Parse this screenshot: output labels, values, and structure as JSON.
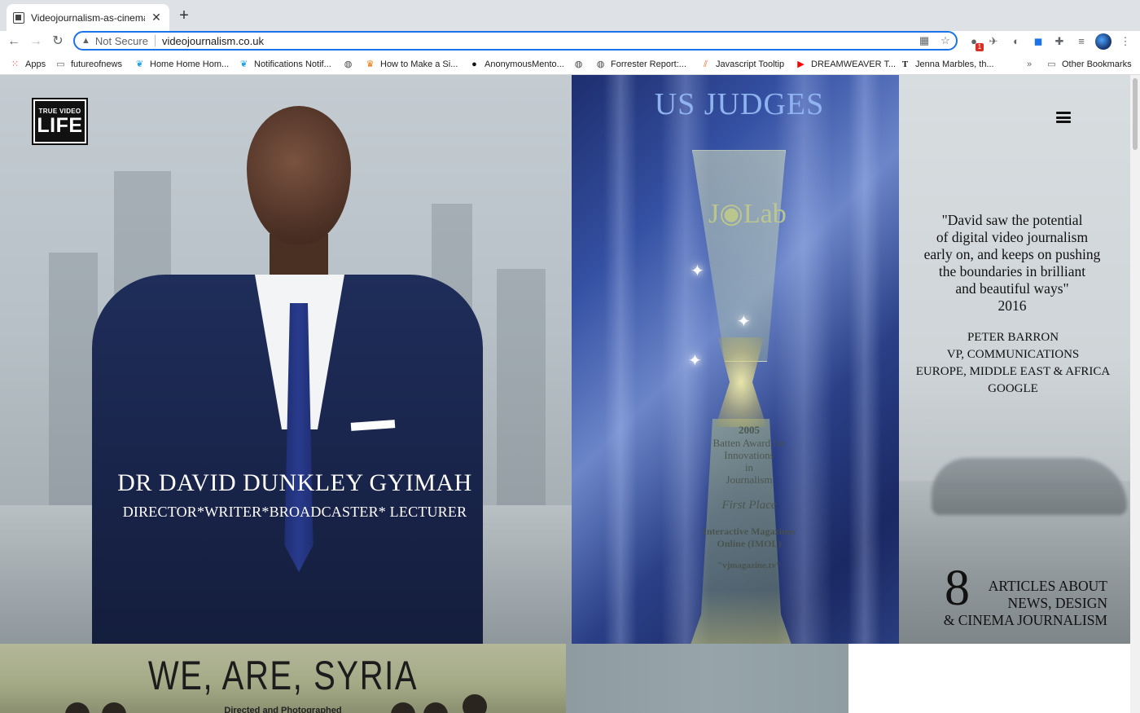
{
  "browser": {
    "tab_title": "Videojournalism-as-cinema | N",
    "security_label": "Not Secure",
    "url": "videojournalism.co.uk",
    "extension_badge": "1"
  },
  "bookmarks": [
    {
      "label": "Apps",
      "icon": "apps-grid-icon"
    },
    {
      "label": "futureofnews",
      "icon": "folder-icon"
    },
    {
      "label": "Home Home Hom...",
      "icon": "twitter-icon"
    },
    {
      "label": "Notifications Notif...",
      "icon": "twitter-icon"
    },
    {
      "label": "",
      "icon": "globe-icon"
    },
    {
      "label": "How to Make a Si...",
      "icon": "site-icon"
    },
    {
      "label": "AnonymousMento...",
      "icon": "tumblr-icon"
    },
    {
      "label": "",
      "icon": "globe-icon"
    },
    {
      "label": "Forrester Report:...",
      "icon": "globe-icon"
    },
    {
      "label": "Javascript Tooltip",
      "icon": "stripes-icon"
    },
    {
      "label": "DREAMWEAVER T...",
      "icon": "youtube-icon"
    },
    {
      "label": "Jenna Marbles, th...",
      "icon": "nytimes-icon"
    },
    {
      "label": "»",
      "icon": ""
    },
    {
      "label": "Other Bookmarks",
      "icon": "folder-icon"
    }
  ],
  "hero": {
    "logo_top": "TRUE VIDEO",
    "logo_bottom": "LIFE",
    "name": "DR DAVID DUNKLEY GYIMAH",
    "subtitle": "DIRECTOR*WRITER*BROADCASTER* LECTURER"
  },
  "award": {
    "heading": "US JUDGES",
    "brand": "J◉Lab",
    "year": "2005",
    "line1": "Batten Award for",
    "line2": "Innovations",
    "line3": "in",
    "line4": "Journalism",
    "place": "First Place",
    "org1": "Interactive Magazines",
    "org2": "Online (IMOL)",
    "site": "\"vjmagazine.tv\""
  },
  "testimonial": {
    "quote_lines": [
      "\"David saw the potential",
      "of digital video journalism",
      "early on, and keeps on pushing",
      "the boundaries in brilliant",
      "and beautiful ways\"",
      "2016"
    ],
    "credit_lines": [
      "PETER BARRON",
      "VP, COMMUNICATIONS",
      "EUROPE, MIDDLE EAST & AFRICA",
      "GOOGLE"
    ]
  },
  "articles": {
    "count": "8",
    "line1": "ARTICLES  ABOUT",
    "line2": "NEWS, DESIGN",
    "line3": "& CINEMA JOURNALISM"
  },
  "syria": {
    "title": "WE, ARE, SYRIA",
    "sub": "Directed and Photographed"
  }
}
